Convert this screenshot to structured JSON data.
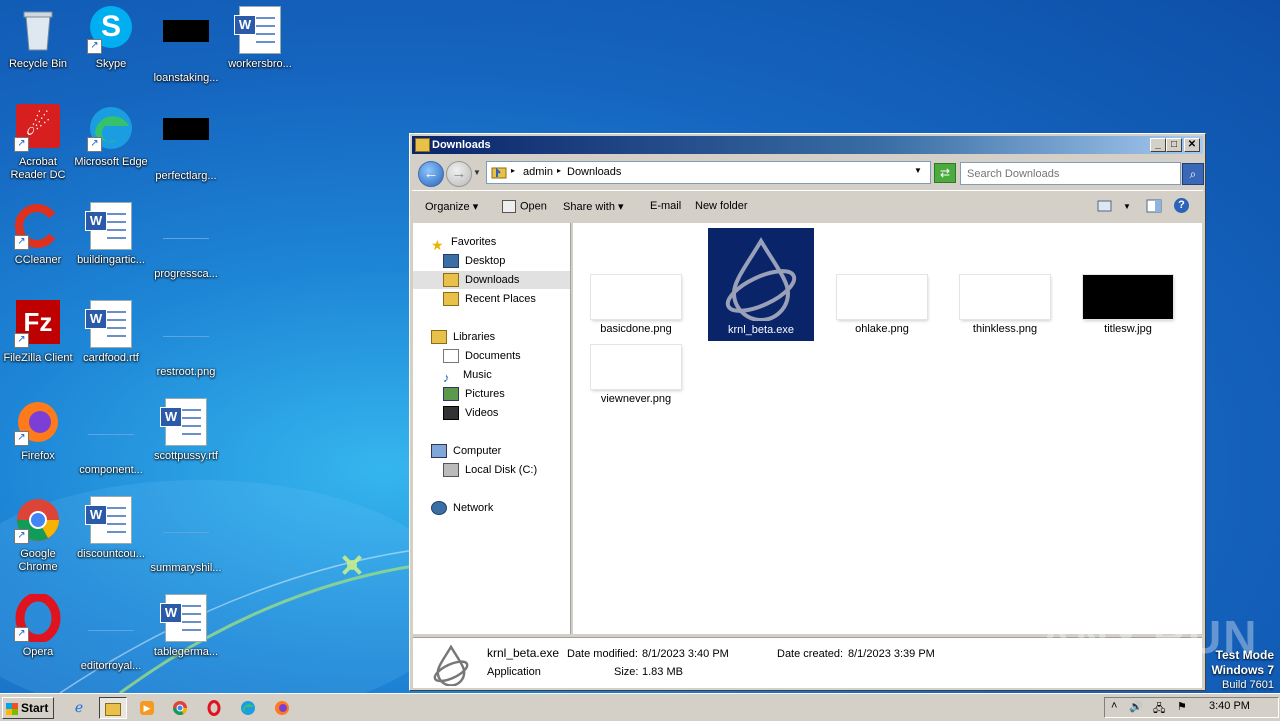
{
  "desktop": {
    "icons": [
      {
        "label": "Recycle Bin",
        "icon": "recycle-bin-icon"
      },
      {
        "label": "Skype",
        "icon": "skype-icon"
      },
      {
        "label": "loanstaking...",
        "icon": "image-thumb-icon"
      },
      {
        "label": "workersbro...",
        "icon": "word-doc-icon"
      },
      {
        "label": "Acrobat Reader DC",
        "icon": "acrobat-icon"
      },
      {
        "label": "Microsoft Edge",
        "icon": "edge-icon"
      },
      {
        "label": "perfectlarg...",
        "icon": "image-thumb-icon"
      },
      {
        "label": "CCleaner",
        "icon": "ccleaner-icon"
      },
      {
        "label": "buildingartic...",
        "icon": "word-doc-icon"
      },
      {
        "label": "progressca...",
        "icon": "image-thumb-icon"
      },
      {
        "label": "FileZilla Client",
        "icon": "filezilla-icon"
      },
      {
        "label": "cardfood.rtf",
        "icon": "word-doc-icon"
      },
      {
        "label": "restroot.png",
        "icon": "image-thumb-icon"
      },
      {
        "label": "Firefox",
        "icon": "firefox-icon"
      },
      {
        "label": "component...",
        "icon": "image-thumb-icon"
      },
      {
        "label": "scottpussy.rtf",
        "icon": "word-doc-icon"
      },
      {
        "label": "Google Chrome",
        "icon": "chrome-icon"
      },
      {
        "label": "discountcou...",
        "icon": "word-doc-icon"
      },
      {
        "label": "summaryshil...",
        "icon": "image-thumb-icon"
      },
      {
        "label": "Opera",
        "icon": "opera-icon"
      },
      {
        "label": "editorroyal...",
        "icon": "image-thumb-icon"
      },
      {
        "label": "tablegerma...",
        "icon": "word-doc-icon"
      }
    ]
  },
  "window": {
    "title": "Downloads",
    "breadcrumb": [
      "admin",
      "Downloads"
    ],
    "search_placeholder": "Search Downloads",
    "toolbar": {
      "organize": "Organize",
      "open": "Open",
      "share_with": "Share with",
      "email": "E-mail",
      "new_folder": "New folder"
    },
    "nav": {
      "favorites": "Favorites",
      "desktop": "Desktop",
      "downloads": "Downloads",
      "recent_places": "Recent Places",
      "libraries": "Libraries",
      "documents": "Documents",
      "music": "Music",
      "pictures": "Pictures",
      "videos": "Videos",
      "computer": "Computer",
      "local_disk": "Local Disk (C:)",
      "network": "Network"
    },
    "files": [
      {
        "name": "basicdone.png"
      },
      {
        "name": "krnl_beta.exe",
        "selected": true
      },
      {
        "name": "ohlake.png"
      },
      {
        "name": "thinkless.png"
      },
      {
        "name": "titlesw.jpg"
      },
      {
        "name": "viewnever.png"
      }
    ],
    "details": {
      "name": "krnl_beta.exe",
      "type": "Application",
      "modified_label": "Date modified:",
      "modified": "8/1/2023 3:40 PM",
      "created_label": "Date created:",
      "created": "8/1/2023 3:39 PM",
      "size_label": "Size:",
      "size": "1.83 MB"
    }
  },
  "taskbar": {
    "start": "Start",
    "clock": "3:40 PM"
  },
  "overlay": {
    "watermark": "ANY.RUN",
    "test_mode": "Test Mode",
    "os": "Windows 7",
    "build": "Build 7601"
  }
}
